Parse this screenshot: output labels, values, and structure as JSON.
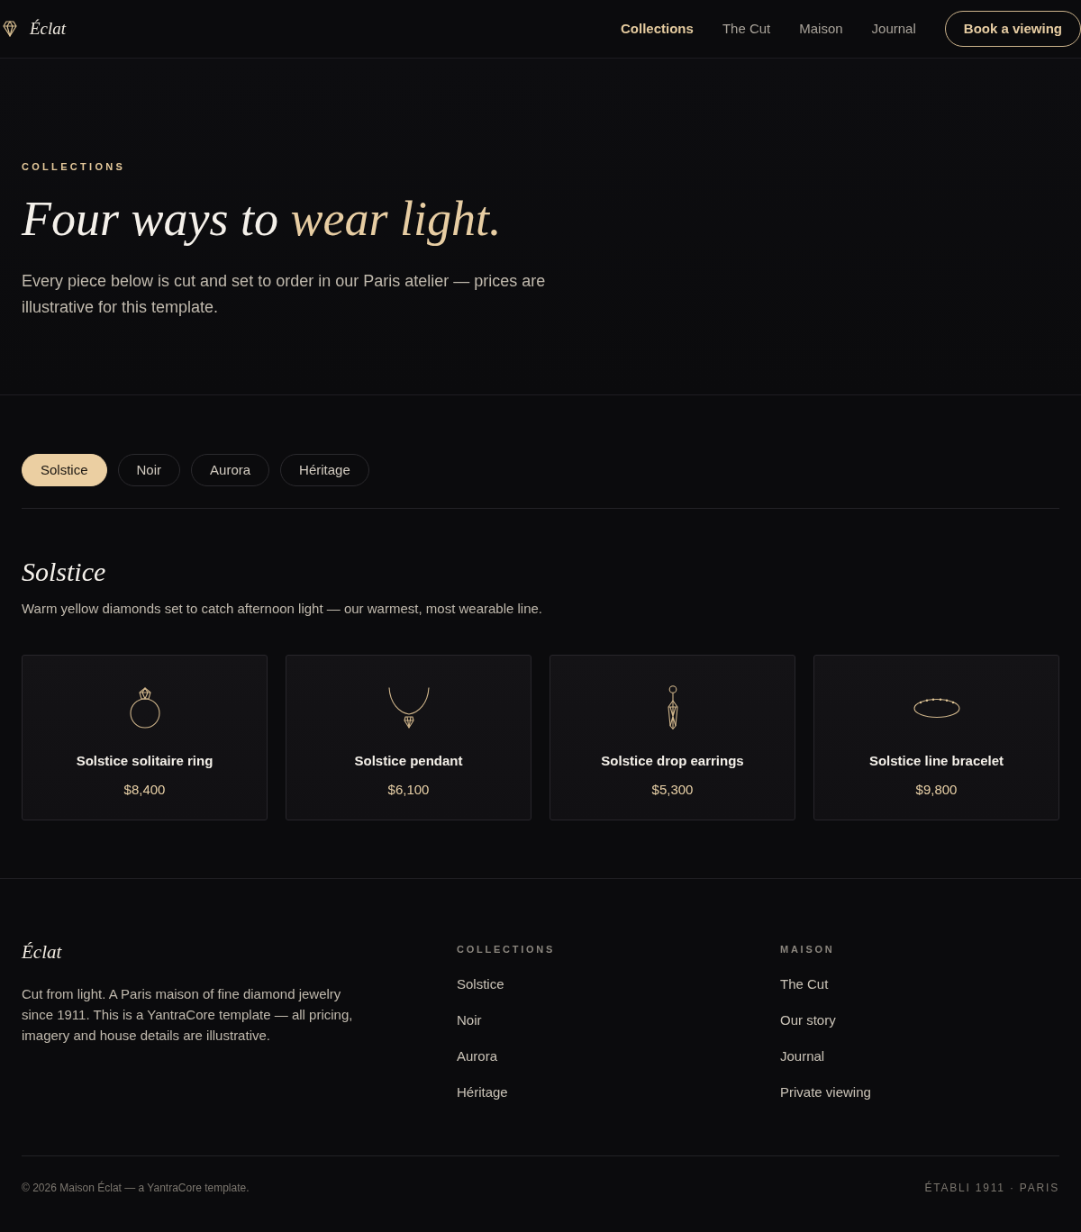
{
  "navbar": {
    "brand": "Éclat",
    "links": [
      {
        "label": "Collections",
        "selected": true
      },
      {
        "label": "The Cut",
        "selected": false
      },
      {
        "label": "Maison",
        "selected": false
      },
      {
        "label": "Journal",
        "selected": false
      }
    ],
    "cta": "Book a viewing"
  },
  "hero": {
    "eyebrow": "COLLECTIONS",
    "heading_lead": "Four ways to",
    "heading_accent": "wear light.",
    "intro": "Every piece below is cut and set to order in our Paris atelier — prices are illustrative for this template."
  },
  "filter_tabs": [
    {
      "label": "Solstice",
      "selected": true
    },
    {
      "label": "Noir",
      "selected": false
    },
    {
      "label": "Aurora",
      "selected": false
    },
    {
      "label": "Héritage",
      "selected": false
    }
  ],
  "collection": {
    "title": "Solstice",
    "description": "Warm yellow diamonds set to catch afternoon light — our warmest, most wearable line.",
    "products": [
      {
        "kind": "ring",
        "name": "Solstice solitaire ring",
        "price": "$8,400"
      },
      {
        "kind": "pendant",
        "name": "Solstice pendant",
        "price": "$6,100"
      },
      {
        "kind": "earrings",
        "name": "Solstice drop earrings",
        "price": "$5,300"
      },
      {
        "kind": "bracelet",
        "name": "Solstice line bracelet",
        "price": "$9,800"
      }
    ]
  },
  "footer": {
    "brand": "Éclat",
    "blurb": "Cut from light. A Paris maison of fine diamond jewelry since 1911. This is a YantraCore template — all pricing, imagery and house details are illustrative.",
    "columns": [
      {
        "heading": "COLLECTIONS",
        "links": [
          "Solstice",
          "Noir",
          "Aurora",
          "Héritage"
        ]
      },
      {
        "heading": "MAISON",
        "links": [
          "The Cut",
          "Our story",
          "Journal",
          "Private viewing"
        ]
      }
    ],
    "copyright": "© 2026 Maison Éclat — a YantraCore template.",
    "tagline": "ÉTABLI 1911 · PARIS"
  }
}
